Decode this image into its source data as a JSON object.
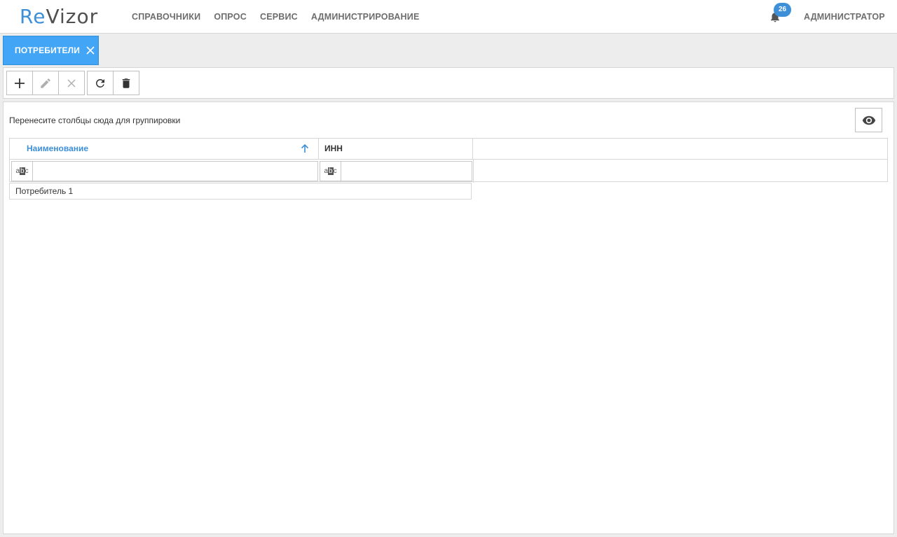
{
  "header": {
    "logo": {
      "re": "Re",
      "rest": "Vizor"
    },
    "menu": [
      {
        "label": "СПРАВОЧНИКИ"
      },
      {
        "label": "ОПРОС"
      },
      {
        "label": "СЕРВИС"
      },
      {
        "label": "АДМИНИСТРИРОВАНИЕ"
      }
    ],
    "notifications_count": "26",
    "user": "АДМИНИСТРАТОР"
  },
  "tabs": [
    {
      "label": "ПОТРЕБИТЕЛИ",
      "active": true
    }
  ],
  "toolbar": {
    "buttons": [
      "add-icon",
      "edit-icon",
      "cancel-icon",
      "refresh-icon",
      "delete-icon"
    ]
  },
  "grid": {
    "group_hint": "Перенесите столбцы сюда для группировки",
    "columns": [
      {
        "title": "Наименование",
        "sorted": "asc"
      },
      {
        "title": "ИНН"
      }
    ],
    "filter_icon_text": {
      "left": "a",
      "mid": "b",
      "right": "c"
    },
    "rows": [
      {
        "name": "Потребитель 1",
        "inn": ""
      }
    ]
  },
  "colors": {
    "accent": "#3d8fd8",
    "tab_active": "#42a5f5"
  }
}
